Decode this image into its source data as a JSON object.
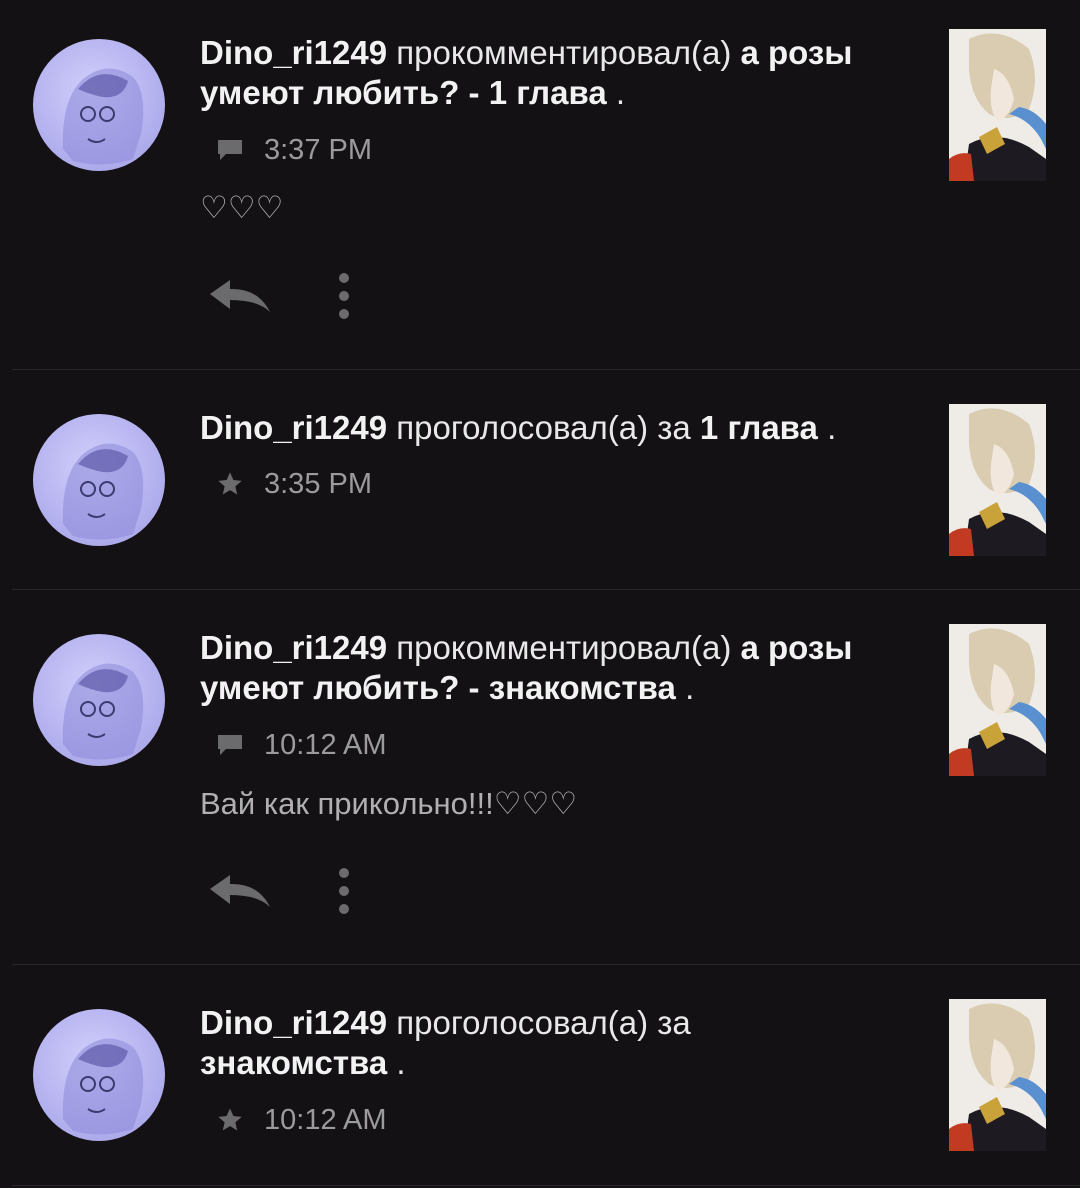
{
  "colors": {
    "background": "#131114",
    "divider": "#2a272b",
    "avatar_bg": "#b6b3f0",
    "meta_text": "#9b9a9c",
    "icon": "#6b6a6d"
  },
  "notifications": [
    {
      "type": "comment",
      "user": "Dino_ri1249",
      "action": "прокомментировал(а)",
      "story": "а розы умеют любить?",
      "separator": "-",
      "part": "1 глава",
      "end": ".",
      "icon": "comment-icon",
      "time": "3:37 PM",
      "comment": "♡♡♡"
    },
    {
      "type": "vote",
      "user": "Dino_ri1249",
      "action": "проголосовал(а) за",
      "part": "1 глава",
      "end": ".",
      "icon": "star-icon",
      "time": "3:35 PM"
    },
    {
      "type": "comment",
      "user": "Dino_ri1249",
      "action": "прокомментировал(а)",
      "story": "а розы умеют любить?",
      "separator": "-",
      "part": "знакомства",
      "end": ".",
      "icon": "comment-icon",
      "time": "10:12 AM",
      "comment": "Вай как прикольно!!!♡♡♡"
    },
    {
      "type": "vote",
      "user": "Dino_ri1249",
      "action": "проголосовал(а) за",
      "part": "знакомства",
      "end": ".",
      "icon": "star-icon",
      "time": "10:12 AM"
    }
  ]
}
